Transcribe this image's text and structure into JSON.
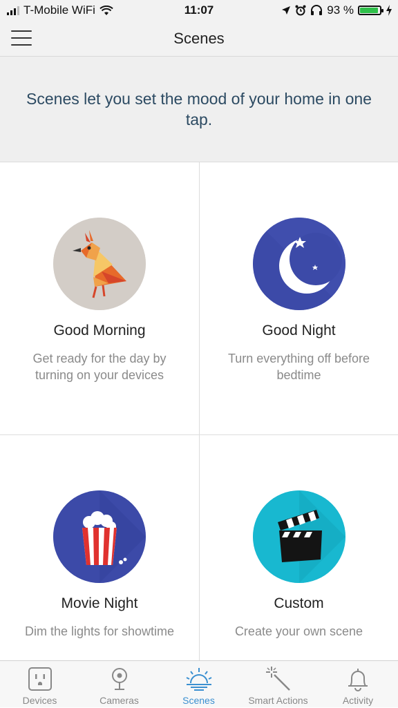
{
  "status_bar": {
    "carrier": "T-Mobile WiFi",
    "time": "11:07",
    "battery_percent": "93 %",
    "battery_level": 0.93,
    "icons": [
      "signal-icon",
      "wifi-icon",
      "location-icon",
      "alarm-icon",
      "headphones-icon",
      "battery-icon",
      "charging-icon"
    ]
  },
  "header": {
    "title": "Scenes",
    "menu_icon": "hamburger-menu-icon"
  },
  "intro": {
    "text": "Scenes let you set the mood of your home in one tap."
  },
  "scenes": [
    {
      "title": "Good Morning",
      "description": "Get ready for the day by turning on your devices",
      "icon": "rooster-icon",
      "color": "#d3cdc7"
    },
    {
      "title": "Good Night",
      "description": "Turn everything off before bedtime",
      "icon": "moon-stars-icon",
      "color": "#3c4aa8"
    },
    {
      "title": "Movie Night",
      "description": "Dim the lights for showtime",
      "icon": "popcorn-icon",
      "color": "#3c4aa8"
    },
    {
      "title": "Custom",
      "description": "Create your own scene",
      "icon": "clapperboard-icon",
      "color": "#18b8d0"
    }
  ],
  "tabs": [
    {
      "label": "Devices",
      "icon": "outlet-icon",
      "active": false
    },
    {
      "label": "Cameras",
      "icon": "camera-icon",
      "active": false
    },
    {
      "label": "Scenes",
      "icon": "sunrise-icon",
      "active": true
    },
    {
      "label": "Smart Actions",
      "icon": "magic-wand-icon",
      "active": false
    },
    {
      "label": "Activity",
      "icon": "bell-icon",
      "active": false
    }
  ],
  "colors": {
    "accent": "#3a8fd0",
    "intro_text": "#2c4a62",
    "battery": "#2fc04a"
  }
}
